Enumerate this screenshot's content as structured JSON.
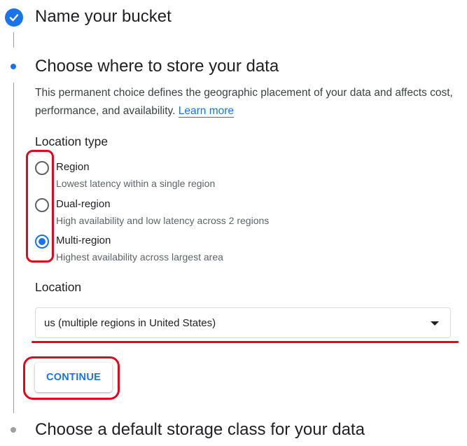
{
  "steps": {
    "completed": {
      "title": "Name your bucket",
      "icon": "check-icon"
    },
    "active": {
      "title": "Choose where to store your data",
      "description": "This permanent choice defines the geographic placement of your data and affects cost, performance, and availability. ",
      "learn_more": "Learn more"
    },
    "next": {
      "title": "Choose a default storage class for your data"
    }
  },
  "location_type": {
    "label": "Location type",
    "options": [
      {
        "label": "Region",
        "description": "Lowest latency within a single region",
        "selected": false
      },
      {
        "label": "Dual-region",
        "description": "High availability and low latency across 2 regions",
        "selected": false
      },
      {
        "label": "Multi-region",
        "description": "Highest availability across largest area",
        "selected": true
      }
    ]
  },
  "location": {
    "label": "Location",
    "selected_value": "us (multiple regions in United States)"
  },
  "actions": {
    "continue_label": "CONTINUE"
  },
  "colors": {
    "accent": "#1a73e8",
    "annotation": "#e0081c"
  }
}
